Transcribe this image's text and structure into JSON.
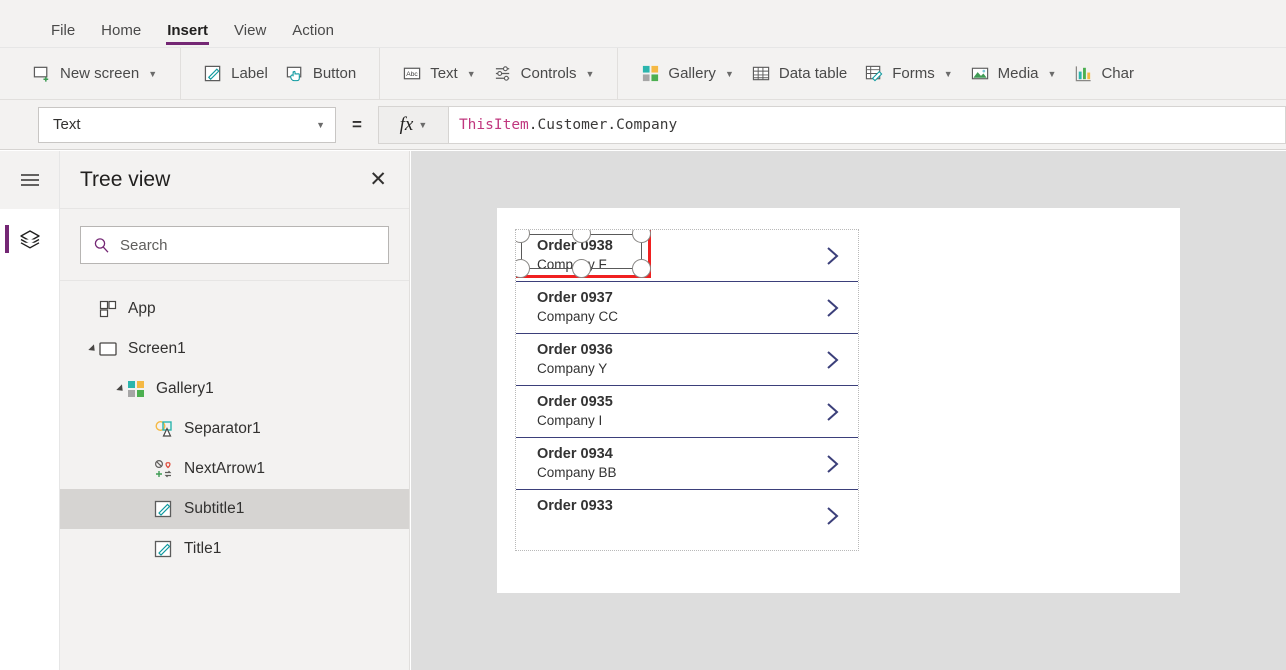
{
  "menubar": {
    "items": [
      {
        "label": "File",
        "active": false
      },
      {
        "label": "Home",
        "active": false
      },
      {
        "label": "Insert",
        "active": true
      },
      {
        "label": "View",
        "active": false
      },
      {
        "label": "Action",
        "active": false
      }
    ],
    "accent_color": "#742774"
  },
  "ribbon": {
    "groups": [
      {
        "buttons": [
          {
            "label": "New screen",
            "icon": "new-screen-icon",
            "caret": true
          }
        ]
      },
      {
        "buttons": [
          {
            "label": "Label",
            "icon": "label-icon",
            "caret": false
          },
          {
            "label": "Button",
            "icon": "button-icon",
            "caret": false
          }
        ]
      },
      {
        "buttons": [
          {
            "label": "Text",
            "icon": "text-icon",
            "caret": true
          },
          {
            "label": "Controls",
            "icon": "controls-icon",
            "caret": true
          }
        ]
      },
      {
        "buttons": [
          {
            "label": "Gallery",
            "icon": "gallery-icon",
            "caret": true
          },
          {
            "label": "Data table",
            "icon": "data-table-icon",
            "caret": false
          },
          {
            "label": "Forms",
            "icon": "forms-icon",
            "caret": true
          },
          {
            "label": "Media",
            "icon": "media-icon",
            "caret": true
          },
          {
            "label": "Char",
            "icon": "charts-icon",
            "caret": false
          }
        ]
      }
    ]
  },
  "formula_bar": {
    "property": "Text",
    "equals": "=",
    "fx_label": "fx",
    "formula_object": "ThisItem",
    "formula_rest": ".Customer.Company",
    "formula_full": "ThisItem.Customer.Company"
  },
  "rail": {
    "hamburger": "hamburger-icon",
    "items": [
      {
        "icon": "layers-icon",
        "active": true
      }
    ]
  },
  "tree": {
    "title": "Tree view",
    "close": "✕",
    "search": {
      "value": "",
      "placeholder": "Search"
    },
    "items": [
      {
        "label": "App",
        "icon": "app-icon",
        "depth": 0,
        "twisty": false,
        "selected": false
      },
      {
        "label": "Screen1",
        "icon": "screen-icon",
        "depth": 1,
        "twisty": true,
        "selected": false
      },
      {
        "label": "Gallery1",
        "icon": "gallery-tree-icon",
        "depth": 2,
        "twisty": true,
        "selected": false
      },
      {
        "label": "Separator1",
        "icon": "shapes-icon",
        "depth": 3,
        "twisty": false,
        "selected": false
      },
      {
        "label": "NextArrow1",
        "icon": "icons-icon",
        "depth": 3,
        "twisty": false,
        "selected": false
      },
      {
        "label": "Subtitle1",
        "icon": "label-tree-icon",
        "depth": 3,
        "twisty": false,
        "selected": true
      },
      {
        "label": "Title1",
        "icon": "label-tree-icon",
        "depth": 3,
        "twisty": false,
        "selected": false
      }
    ]
  },
  "canvas": {
    "background_color": "#dddddd",
    "screen_color": "#ffffff",
    "selection_color": "#f02020",
    "separator_color": "#3b3f7a",
    "gallery_rows": [
      {
        "title": "Order 0938",
        "subtitle": "Company F",
        "selected": true
      },
      {
        "title": "Order 0937",
        "subtitle": "Company CC",
        "selected": false
      },
      {
        "title": "Order 0936",
        "subtitle": "Company Y",
        "selected": false
      },
      {
        "title": "Order 0935",
        "subtitle": "Company I",
        "selected": false
      },
      {
        "title": "Order 0934",
        "subtitle": "Company BB",
        "selected": false
      },
      {
        "title": "Order 0933",
        "subtitle": "",
        "selected": false
      }
    ]
  }
}
